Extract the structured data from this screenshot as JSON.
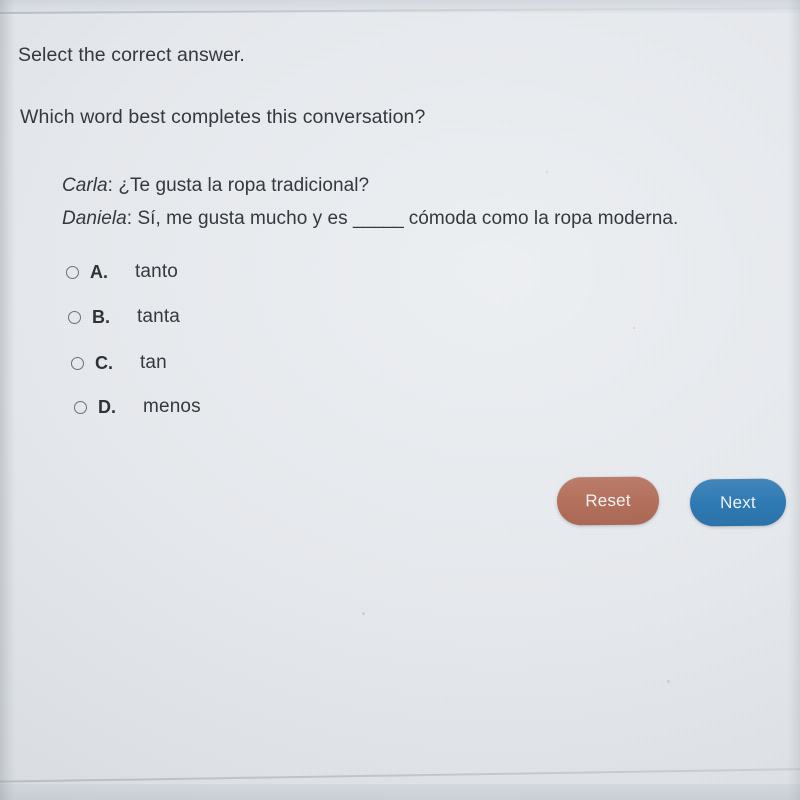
{
  "prompts": {
    "instruction": "Select the correct answer.",
    "question": "Which word best completes this conversation?"
  },
  "dialogue": [
    {
      "speaker": "Carla",
      "separator": ": ",
      "text": "¿Te gusta la ropa tradicional?"
    },
    {
      "speaker": "Daniela",
      "separator": ": ",
      "text_before_blank": "Sí, me gusta mucho y es ",
      "blank": "_____",
      "text_after_blank": " cómoda como la ropa moderna."
    }
  ],
  "options": [
    {
      "letter": "A.",
      "text": "tanto",
      "selected": false
    },
    {
      "letter": "B.",
      "text": "tanta",
      "selected": false
    },
    {
      "letter": "C.",
      "text": "tan",
      "selected": false
    },
    {
      "letter": "D.",
      "text": "menos",
      "selected": false
    }
  ],
  "buttons": {
    "reset": "Reset",
    "next": "Next"
  },
  "colors": {
    "reset_button": "#b5705c",
    "next_button": "#2e7ab5",
    "text": "#35393e",
    "background": "#e9ecf0",
    "radio_outline": "#6d7278"
  }
}
